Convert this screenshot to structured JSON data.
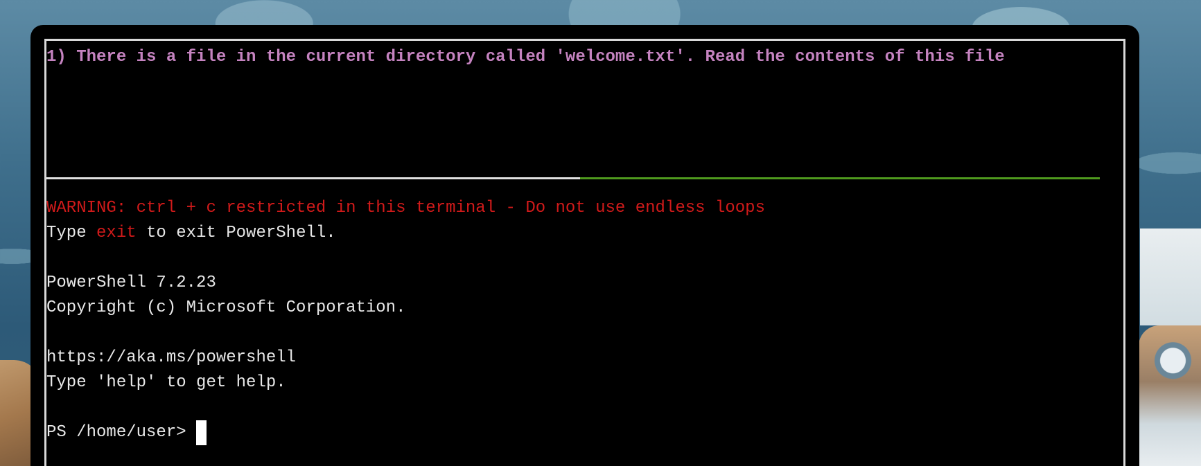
{
  "task": {
    "text": "1) There is a file in the current directory called 'welcome.txt'. Read the contents of this file"
  },
  "terminal": {
    "warning": "WARNING: ctrl + c restricted in this terminal - Do not use endless loops",
    "exit_hint": {
      "prefix": "Type ",
      "keyword": "exit",
      "suffix": " to exit PowerShell."
    },
    "version_line": "PowerShell 7.2.23",
    "copyright_line": "Copyright (c) Microsoft Corporation.",
    "url_line": "https://aka.ms/powershell",
    "help_line": "Type 'help' to get help.",
    "prompt": "PS /home/user> "
  },
  "colors": {
    "task_text": "#c583c0",
    "warning": "#d11a1a",
    "console_text": "#e8e8e8",
    "divider_progress": "#4f9a1e",
    "divider_rest": "#e0e0e0"
  }
}
